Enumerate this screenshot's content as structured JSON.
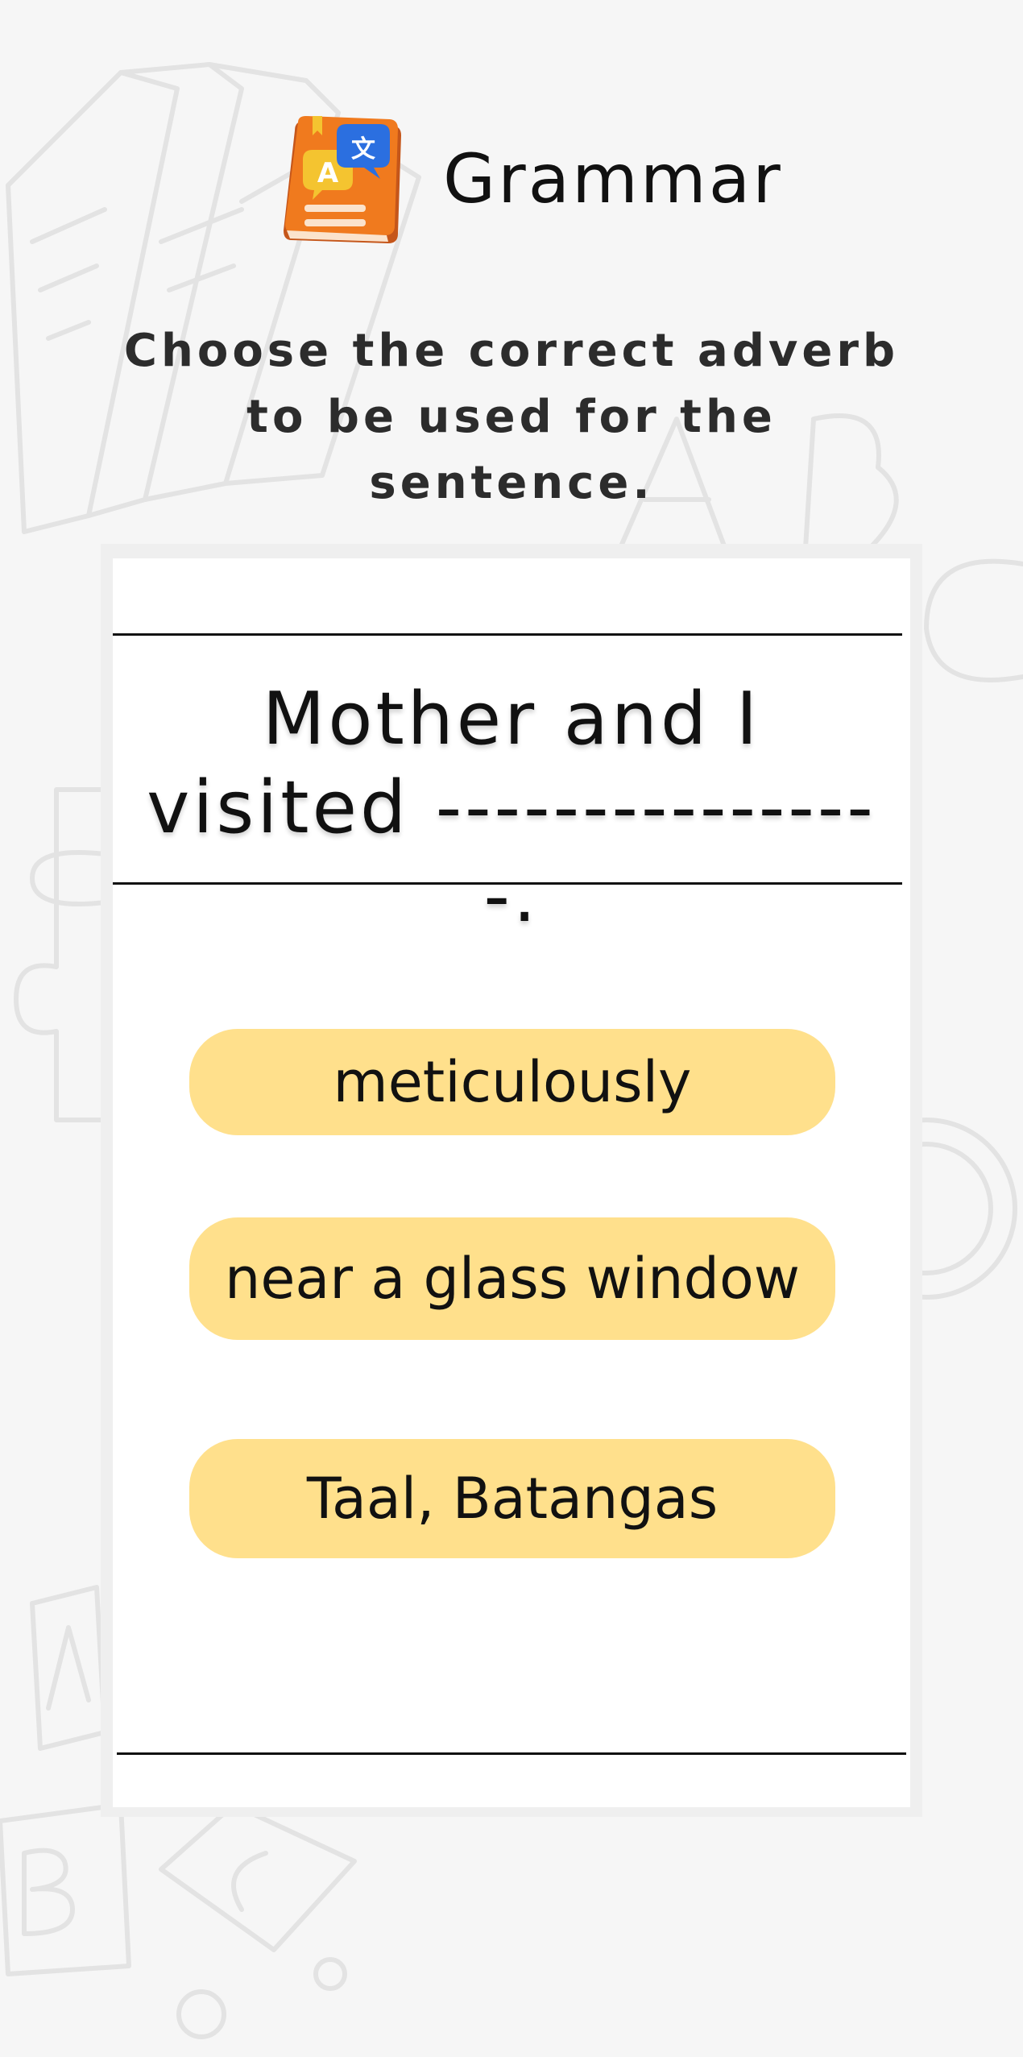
{
  "header": {
    "title": "Grammar",
    "icon": "translate-book-icon"
  },
  "instruction": "Choose the correct adverb to be used for the sentence.",
  "question": {
    "sentence": "Mother and I visited ----------------."
  },
  "options": [
    {
      "label": "meticulously"
    },
    {
      "label": "near a glass window"
    },
    {
      "label": "Taal, Batangas"
    }
  ],
  "colors": {
    "background": "#f6f6f6",
    "card": "#ffffff",
    "option_fill": "#ffe08c",
    "book_orange": "#f07a1e",
    "bubble_blue": "#2b6fe0",
    "bubble_yellow": "#f4c430"
  }
}
